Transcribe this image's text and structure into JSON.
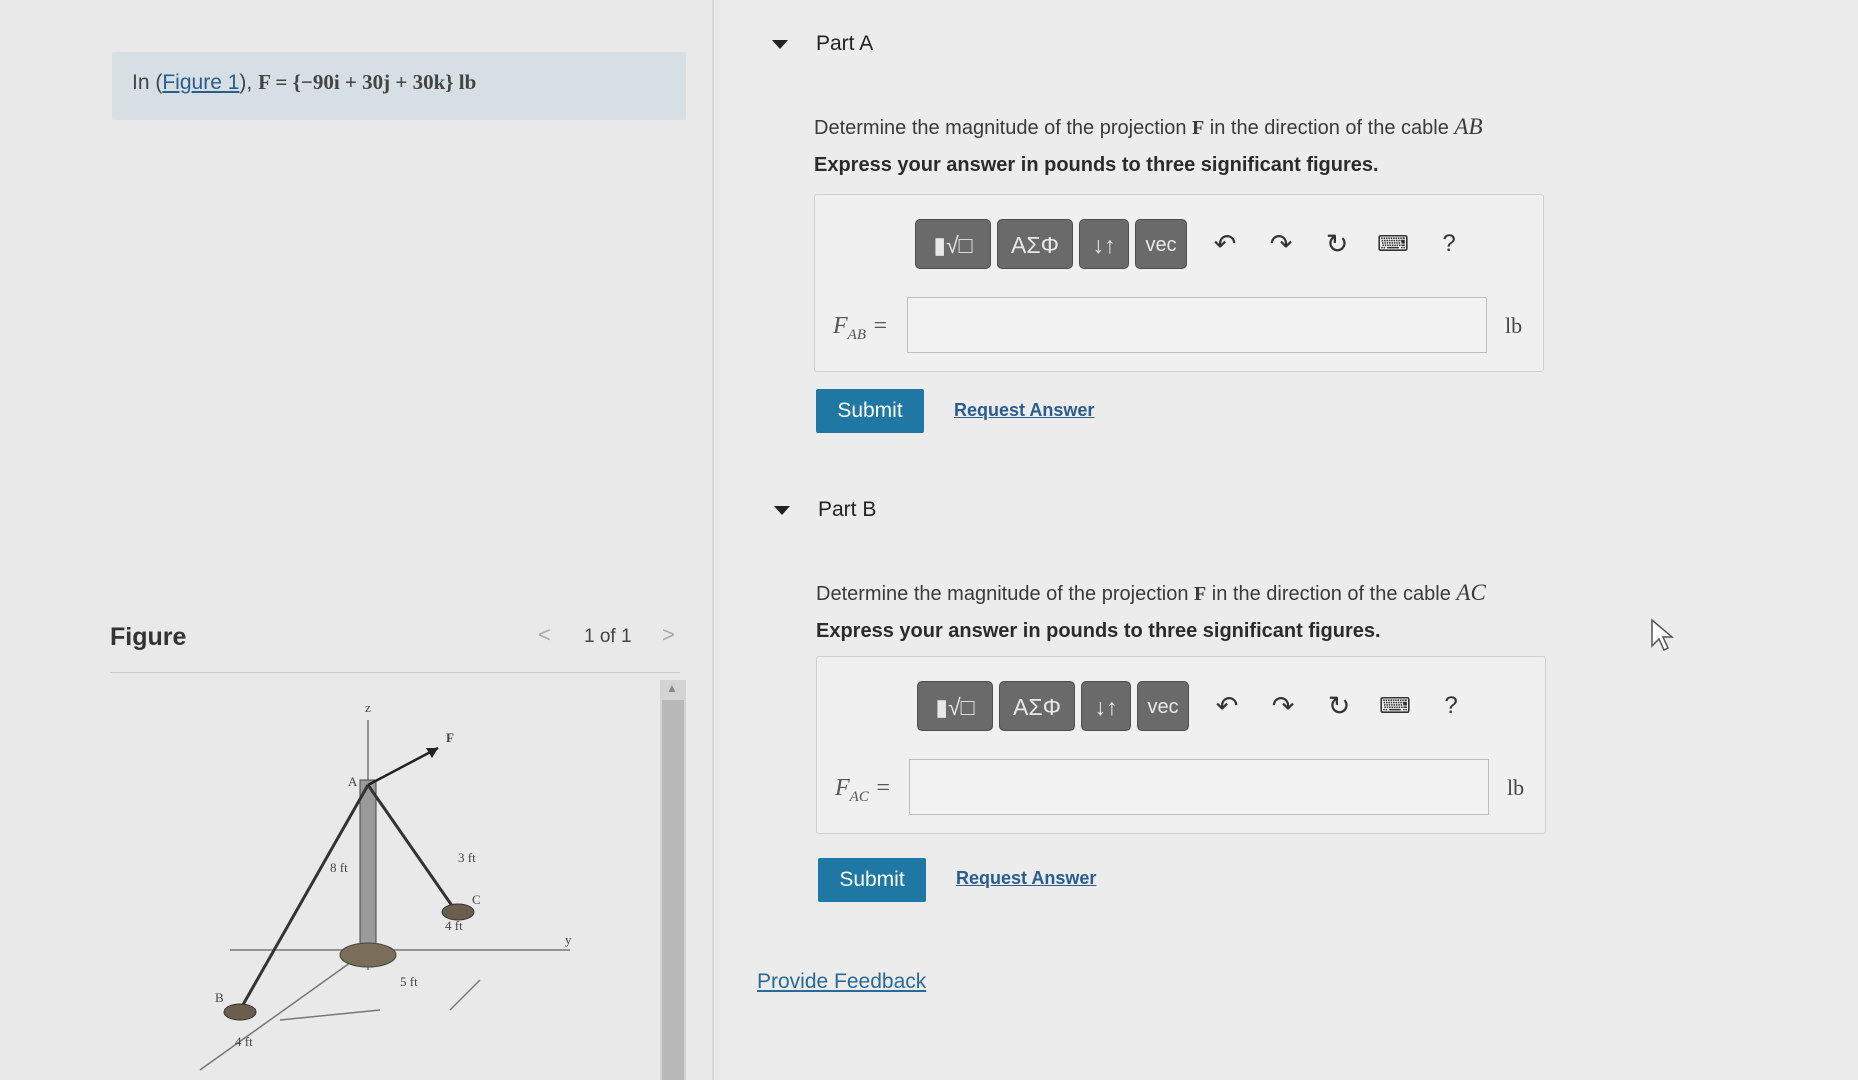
{
  "problem": {
    "prefix": "In (",
    "figure_link": "Figure 1",
    "suffix": "),",
    "force_equation": "F = {−90i + 30j + 30k} lb"
  },
  "figure": {
    "title": "Figure",
    "counter": "1 of 1",
    "labels": {
      "z": "z",
      "F": "F",
      "A": "A",
      "B": "B",
      "C": "C",
      "y": "y",
      "d8": "8 ft",
      "d3": "3 ft",
      "d4a": "4 ft",
      "d5": "5 ft",
      "d4b": "4 ft"
    }
  },
  "part_a": {
    "header": "Part A",
    "question_pre": "Determine the magnitude of the projection",
    "question_F": "F",
    "question_mid": "in the direction of the cable",
    "question_cable": "AB",
    "instruction": "Express your answer in pounds to three significant figures.",
    "var": "F",
    "var_sub": "AB",
    "unit": "lb",
    "submit": "Submit",
    "request": "Request Answer"
  },
  "part_b": {
    "header": "Part B",
    "question_pre": "Determine the magnitude of the projection",
    "question_F": "F",
    "question_mid": "in the direction of the cable",
    "question_cable": "AC",
    "instruction": "Express your answer in pounds to three significant figures.",
    "var": "F",
    "var_sub": "AC",
    "unit": "lb",
    "submit": "Submit",
    "request": "Request Answer"
  },
  "toolbar": {
    "greek": "ΑΣΦ",
    "arrows": "↓↑",
    "vec": "vec",
    "help": "?"
  },
  "footer": {
    "feedback": "Provide Feedback"
  }
}
